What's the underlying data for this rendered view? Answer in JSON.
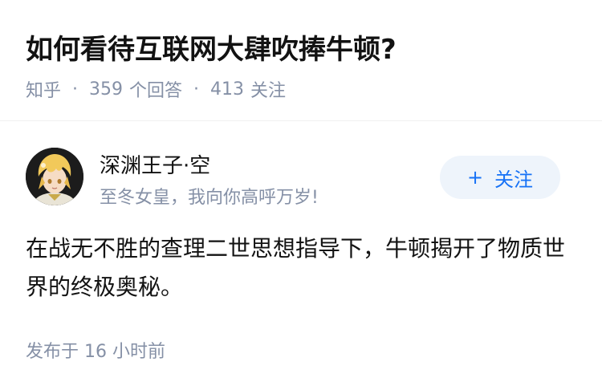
{
  "question": {
    "title": "如何看待互联网大肆吹捧牛顿?",
    "source": "知乎",
    "answers_count": "359",
    "answers_label": "个回答",
    "followers_count": "413",
    "followers_label": "关注",
    "separator": "·"
  },
  "author": {
    "name": "深渊王子·空",
    "bio": "至冬女皇，我向你高呼万岁!",
    "avatar_icon": "avatar-blonde-character"
  },
  "follow_button": {
    "icon": "+",
    "label": "关注"
  },
  "answer": {
    "content": "在战无不胜的查理二世思想指导下，牛顿揭开了物质世界的终极奥秘。",
    "publish_time": "发布于 16 小时前"
  },
  "colors": {
    "accent": "#1772f6",
    "muted": "#8590a6",
    "button_bg": "#eef4fb"
  }
}
